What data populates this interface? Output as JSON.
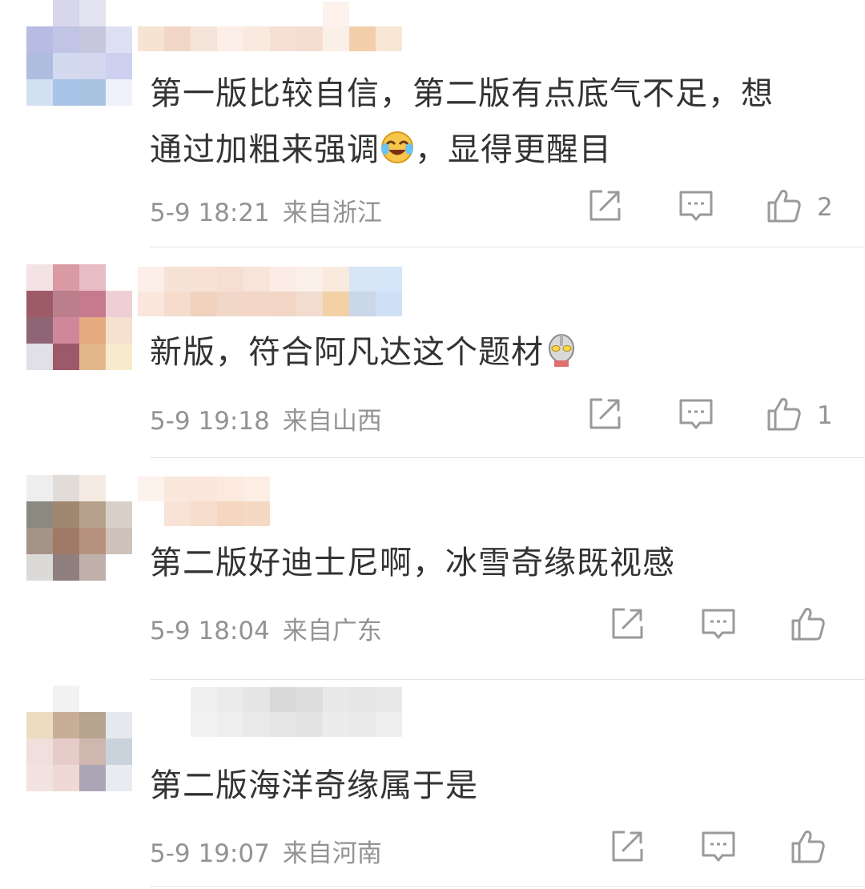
{
  "comments": [
    {
      "text_lines": [
        "第一版比较自信，第二版有点底气不足，想",
        "通过加粗来强调",
        "，显得更醒目"
      ],
      "emoji": "laughing-tears-emoji",
      "time": "5-9 18:21",
      "location": "来自浙江",
      "likes": "2",
      "avatar_colors": [
        "#ffffff",
        "#d8d6ec",
        "#e3e2f1",
        "#ffffff",
        "#b8bce4",
        "#c2c4e6",
        "#c6c6dc",
        "#dde0f2",
        "#aebce0",
        "#d3daf0",
        "#d4d8ef",
        "#cdd0ee",
        "#d2e0f2",
        "#a8c4e6",
        "#a9c2e1",
        "#eef1fa"
      ],
      "name_colors": [
        "#ffffff",
        "#f7e3d2",
        "#ffffff",
        "#f1d6c6",
        "#ffffff",
        "#f5e4da",
        "#ffffff",
        "#fbeee6",
        "#ffffff",
        "#f9e9df",
        "#ffffff",
        "#f7dfd3",
        "#ffffff",
        "#f5ddd0",
        "#fdf3ec",
        "#fbf0e8",
        "#ffffff",
        "#f2cfaa",
        "#ffffff",
        "#f8e6d4"
      ]
    },
    {
      "text_lines": [
        "新版，符合阿凡达这个题材"
      ],
      "emoji": "ultraman-emoji",
      "time": "5-9 19:18",
      "location": "来自山西",
      "likes": "1",
      "avatar_colors": [
        "#f4e3e6",
        "#d99aa4",
        "#e8bcc3",
        "#ffffff",
        "#9c5b67",
        "#bb7f8c",
        "#c7798e",
        "#eecfd6",
        "#8f6575",
        "#d1879a",
        "#e5aa7f",
        "#f6e0cf",
        "#e1dfe7",
        "#9c5969",
        "#e3b98c",
        "#f8ebcd"
      ],
      "name_colors": [
        "#fcefe9",
        "#fae6dc",
        "#f7e2d6",
        "#f5dccd",
        "#f8e2d6",
        "#f1d2bf",
        "#f5dfd3",
        "#f1d7c8",
        "#f8e4d9",
        "#f2d7c7",
        "#fbece5",
        "#f1d6c6",
        "#fbf0ea",
        "#f2dccf",
        "#fae9dd",
        "#f3d1a7",
        "#d7e5f4",
        "#cad7e8",
        "#d4e6f7",
        "#cde0f5"
      ]
    },
    {
      "text_lines": [
        "第二版好迪士尼啊，冰雪奇缘既视感"
      ],
      "emoji": "",
      "time": "5-9 18:04",
      "location": "来自广东",
      "likes": "",
      "avatar_colors": [
        "#eeeeee",
        "#e2dcd8",
        "#f5ebe3",
        "#ffffff",
        "#8c8a80",
        "#a08870",
        "#b6a28c",
        "#d8d0c8",
        "#a49488",
        "#a07a66",
        "#b6917d",
        "#cfc2bb",
        "#dcdad8",
        "#8f7f7e",
        "#bfb0aa",
        "#ffffff"
      ],
      "name_colors": [
        "#fdf2ec",
        "#ffffff",
        "#fae8dc",
        "#f8e3d6",
        "#fae6da",
        "#f6ddcc",
        "#fbeadd",
        "#f5d6c0",
        "#fceee4",
        "#f6d9c4"
      ]
    },
    {
      "text_lines": [
        "第二版海洋奇缘属于是"
      ],
      "emoji": "",
      "time": "5-9 19:07",
      "location": "来自河南",
      "likes": "",
      "avatar_colors": [
        "#ffffff",
        "#f2f2f2",
        "#ffffff",
        "#ffffff",
        "#ecdcc0",
        "#c8ad98",
        "#b6a48f",
        "#e5e8ec",
        "#efe0dd",
        "#e6ccc8",
        "#cfb6ae",
        "#cad2dc",
        "#f2e2e0",
        "#efd9d4",
        "#aba6b5",
        "#e8ecf0"
      ],
      "name_colors": [
        "#ffffff",
        "#ffffff",
        "#ffffff",
        "#ffffff",
        "#f0f0f0",
        "#f2f2f2",
        "#ebebeb",
        "#eeeeee",
        "#e5e5e5",
        "#e9e9e9",
        "#d9d9d9",
        "#e6e6e6",
        "#dddddd",
        "#e3e3e3",
        "#e8e8e8",
        "#ececec",
        "#e6e6e6",
        "#eaeaea",
        "#e8e8e8",
        "#eeeeee"
      ]
    }
  ],
  "icons": {
    "share": "share-icon",
    "comment": "comment-icon",
    "like": "thumbs-up-icon"
  }
}
